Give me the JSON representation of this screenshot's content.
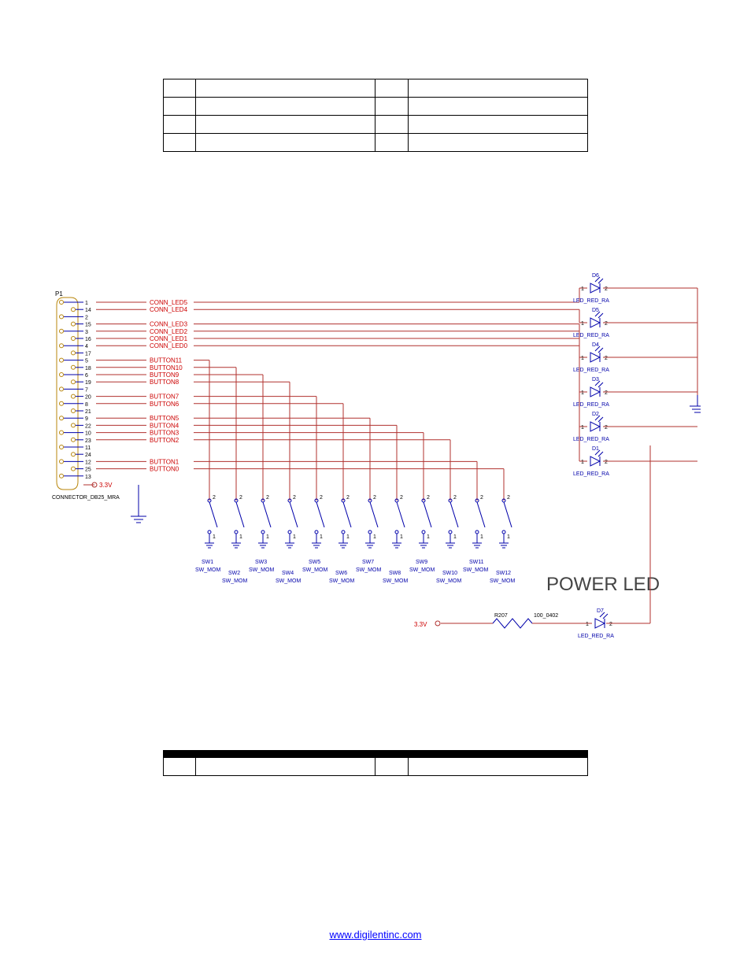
{
  "table1": {
    "rows": [
      [
        "",
        "",
        "",
        ""
      ],
      [
        "",
        "",
        "",
        ""
      ],
      [
        "",
        "",
        "",
        ""
      ],
      [
        "",
        "",
        "",
        ""
      ]
    ]
  },
  "table2": {
    "head": [
      "",
      "",
      "",
      ""
    ],
    "rows": [
      [
        "",
        "",
        "",
        ""
      ]
    ]
  },
  "schematic": {
    "connector_ref": "P1",
    "connector_name": "CONNECTOR_DB25_MRA",
    "power_net": "3.3V",
    "pins_left": [
      "1",
      "2",
      "3",
      "4",
      "5",
      "6",
      "7",
      "8",
      "9",
      "10",
      "11",
      "12",
      "13"
    ],
    "pins_right": [
      "14",
      "15",
      "16",
      "17",
      "18",
      "19",
      "20",
      "21",
      "22",
      "23",
      "24",
      "25"
    ],
    "nets": [
      "CONN_LED5",
      "CONN_LED4",
      "CONN_LED3",
      "CONN_LED2",
      "CONN_LED1",
      "CONN_LED0",
      "BUTTON11",
      "BUTTON10",
      "BUTTON9",
      "BUTTON8",
      "BUTTON7",
      "BUTTON6",
      "BUTTON5",
      "BUTTON4",
      "BUTTON3",
      "BUTTON2",
      "BUTTON1",
      "BUTTON0"
    ],
    "switches": [
      {
        "ref": "SW1",
        "val": "SW_MOM"
      },
      {
        "ref": "SW2",
        "val": "SW_MOM"
      },
      {
        "ref": "SW3",
        "val": "SW_MOM"
      },
      {
        "ref": "SW4",
        "val": "SW_MOM"
      },
      {
        "ref": "SW5",
        "val": "SW_MOM"
      },
      {
        "ref": "SW6",
        "val": "SW_MOM"
      },
      {
        "ref": "SW7",
        "val": "SW_MOM"
      },
      {
        "ref": "SW8",
        "val": "SW_MOM"
      },
      {
        "ref": "SW9",
        "val": "SW_MOM"
      },
      {
        "ref": "SW10",
        "val": "SW_MOM"
      },
      {
        "ref": "SW11",
        "val": "SW_MOM"
      },
      {
        "ref": "SW12",
        "val": "SW_MOM"
      }
    ],
    "leds": [
      {
        "ref": "D6",
        "val": "LED_RED_RA"
      },
      {
        "ref": "D5",
        "val": "LED_RED_RA"
      },
      {
        "ref": "D4",
        "val": "LED_RED_RA"
      },
      {
        "ref": "D3",
        "val": "LED_RED_RA"
      },
      {
        "ref": "D2",
        "val": "LED_RED_RA"
      },
      {
        "ref": "D1",
        "val": "LED_RED_RA"
      }
    ],
    "power_led": {
      "ref": "D7",
      "val": "LED_RED_RA",
      "r_ref": "R207",
      "r_val": "100_0402",
      "supply": "3.3V",
      "title": "POWER LED"
    }
  },
  "footer": {
    "url": "www.digilentinc.com"
  }
}
